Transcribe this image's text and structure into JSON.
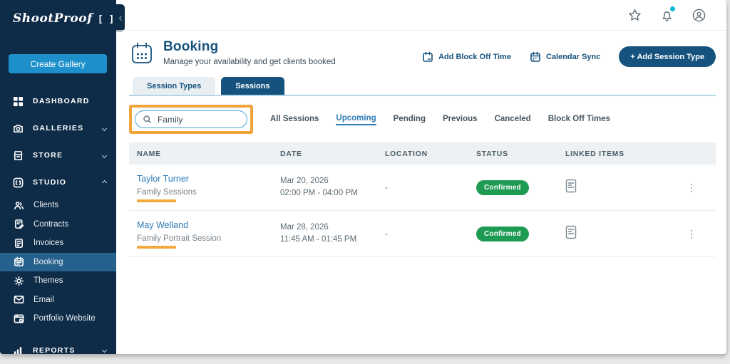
{
  "brand": {
    "logo": "ShootProof",
    "logo_marks": "[ ]"
  },
  "sidebar": {
    "create_gallery": "Create Gallery",
    "dashboard": "DASHBOARD",
    "galleries": "GALLERIES",
    "store": "STORE",
    "studio": "STUDIO",
    "studio_children": [
      "Clients",
      "Contracts",
      "Invoices",
      "Booking",
      "Themes",
      "Email",
      "Portfolio Website"
    ],
    "reports": "REPORTS",
    "active_item": "Booking"
  },
  "header": {
    "title": "Booking",
    "subtitle": "Manage your availability and get clients booked",
    "actions": {
      "add_block_off_time": "Add Block Off Time",
      "calendar_sync": "Calendar Sync",
      "add_session_type": "+ Add Session Type"
    }
  },
  "tabs": {
    "session_types": "Session Types",
    "sessions": "Sessions",
    "active": "Sessions"
  },
  "search": {
    "value": "Family"
  },
  "filters": {
    "items": [
      "All Sessions",
      "Upcoming",
      "Pending",
      "Previous",
      "Canceled",
      "Block Off Times"
    ],
    "active": "Upcoming"
  },
  "table": {
    "columns": [
      "NAME",
      "DATE",
      "LOCATION",
      "STATUS",
      "LINKED ITEMS"
    ],
    "rows": [
      {
        "name": "Taylor Turner",
        "session_type": "Family Sessions",
        "date": "Mar 20, 2026",
        "time": "02:00 PM - 04:00 PM",
        "location": "-",
        "status": "Confirmed"
      },
      {
        "name": "May Welland",
        "session_type": "Family Portrait Session",
        "date": "Mar 28, 2026",
        "time": "11:45 AM - 01:45 PM",
        "location": "-",
        "status": "Confirmed"
      }
    ]
  },
  "colors": {
    "sidebar_navy": "#0e2b47",
    "active_nav": "#26608c",
    "accent_blue": "#1d90cb",
    "brand_navy": "#15537e",
    "link_blue": "#2e7cb8",
    "badge_green": "#1e9b53",
    "annotation_orange": "#f2a43c",
    "notification_teal": "#00b8d4"
  }
}
